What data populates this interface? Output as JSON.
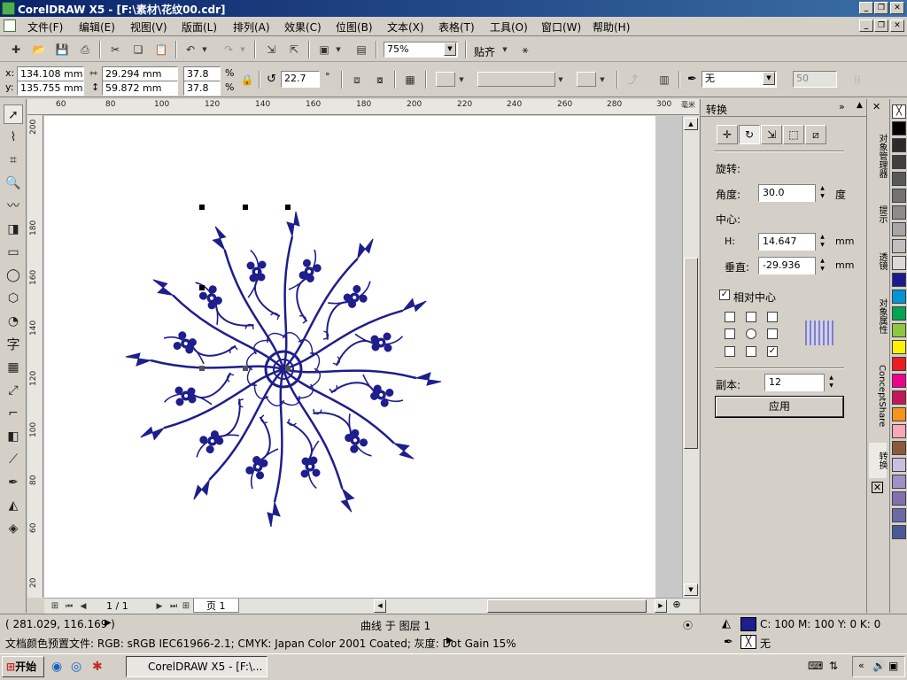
{
  "window": {
    "title": "CorelDRAW X5 - [F:\\素材\\花纹00.cdr]"
  },
  "menu": [
    "文件(F)",
    "编辑(E)",
    "视图(V)",
    "版面(L)",
    "排列(A)",
    "效果(C)",
    "位图(B)",
    "文本(X)",
    "表格(T)",
    "工具(O)",
    "窗口(W)",
    "帮助(H)"
  ],
  "toolbar": {
    "zoom": "75%",
    "snap_label": "贴齐"
  },
  "props": {
    "x_label": "x:",
    "x_value": "134.108 mm",
    "y_label": "y:",
    "y_value": "135.755 mm",
    "w_value": "29.294 mm",
    "h_value": "59.872 mm",
    "scale_x": "37.8",
    "scale_y": "37.8",
    "pct": "%",
    "angle": "22.7",
    "degree_symbol": "°",
    "outline": "无",
    "opacity": "50"
  },
  "ruler": {
    "top_ticks": [
      "60",
      "80",
      "100",
      "120",
      "140",
      "160",
      "180",
      "200",
      "220",
      "240",
      "260",
      "280",
      "300"
    ],
    "top_unit": "毫米",
    "left_ticks": [
      "200",
      "180",
      "160",
      "140",
      "120",
      "100",
      "80",
      "60",
      "40",
      "20"
    ]
  },
  "docker": {
    "title": "转换",
    "section": "旋转:",
    "angle_label": "角度:",
    "angle_value": "30.0",
    "angle_unit": "度",
    "center_label": "中心:",
    "h_label": "H:",
    "h_value": "14.647",
    "h_unit": "mm",
    "v_label": "垂直:",
    "v_value": "-29.936",
    "v_unit": "mm",
    "relative_label": "相对中心",
    "relative_checked": true,
    "copies_label": "副本:",
    "copies_value": "12",
    "apply_label": "应用"
  },
  "side_tabs": [
    "对象管理器",
    "提示",
    "透镜",
    "对象属性",
    "ConceptShare",
    "转换"
  ],
  "palette": [
    "#ffffff",
    "#000000",
    "#2b2b2b",
    "#404040",
    "#595959",
    "#737373",
    "#8c8c8c",
    "#a6a6a6",
    "#bfbfbf",
    "#d9d9d9",
    "#1a1a8c",
    "#0096d6",
    "#00a651",
    "#8dc63f",
    "#fff200",
    "#ed1c24",
    "#ec008c",
    "#c2185b",
    "#f7941d",
    "#f9a8b8",
    "#8b5a3c",
    "#c8c0e0",
    "#a090c8",
    "#8070b0",
    "#6a6aa8",
    "#4a5a98"
  ],
  "pages": {
    "nav": "1 / 1",
    "tab": "页 1"
  },
  "status": {
    "coords": "( 281.029, 116.169 )",
    "object": "曲线 于 图层 1",
    "color_profile": "文档颜色预置文件: RGB: sRGB IEC61966-2.1; CMYK: Japan Color 2001 Coated; 灰度: Dot Gain 15%",
    "fill": "C: 100 M: 100 Y: 0 K: 0",
    "fill_color": "#1e1e8c",
    "outline": "无"
  },
  "taskbar": {
    "start": "开始",
    "task": "CorelDRAW X5 - [F:\\..."
  }
}
